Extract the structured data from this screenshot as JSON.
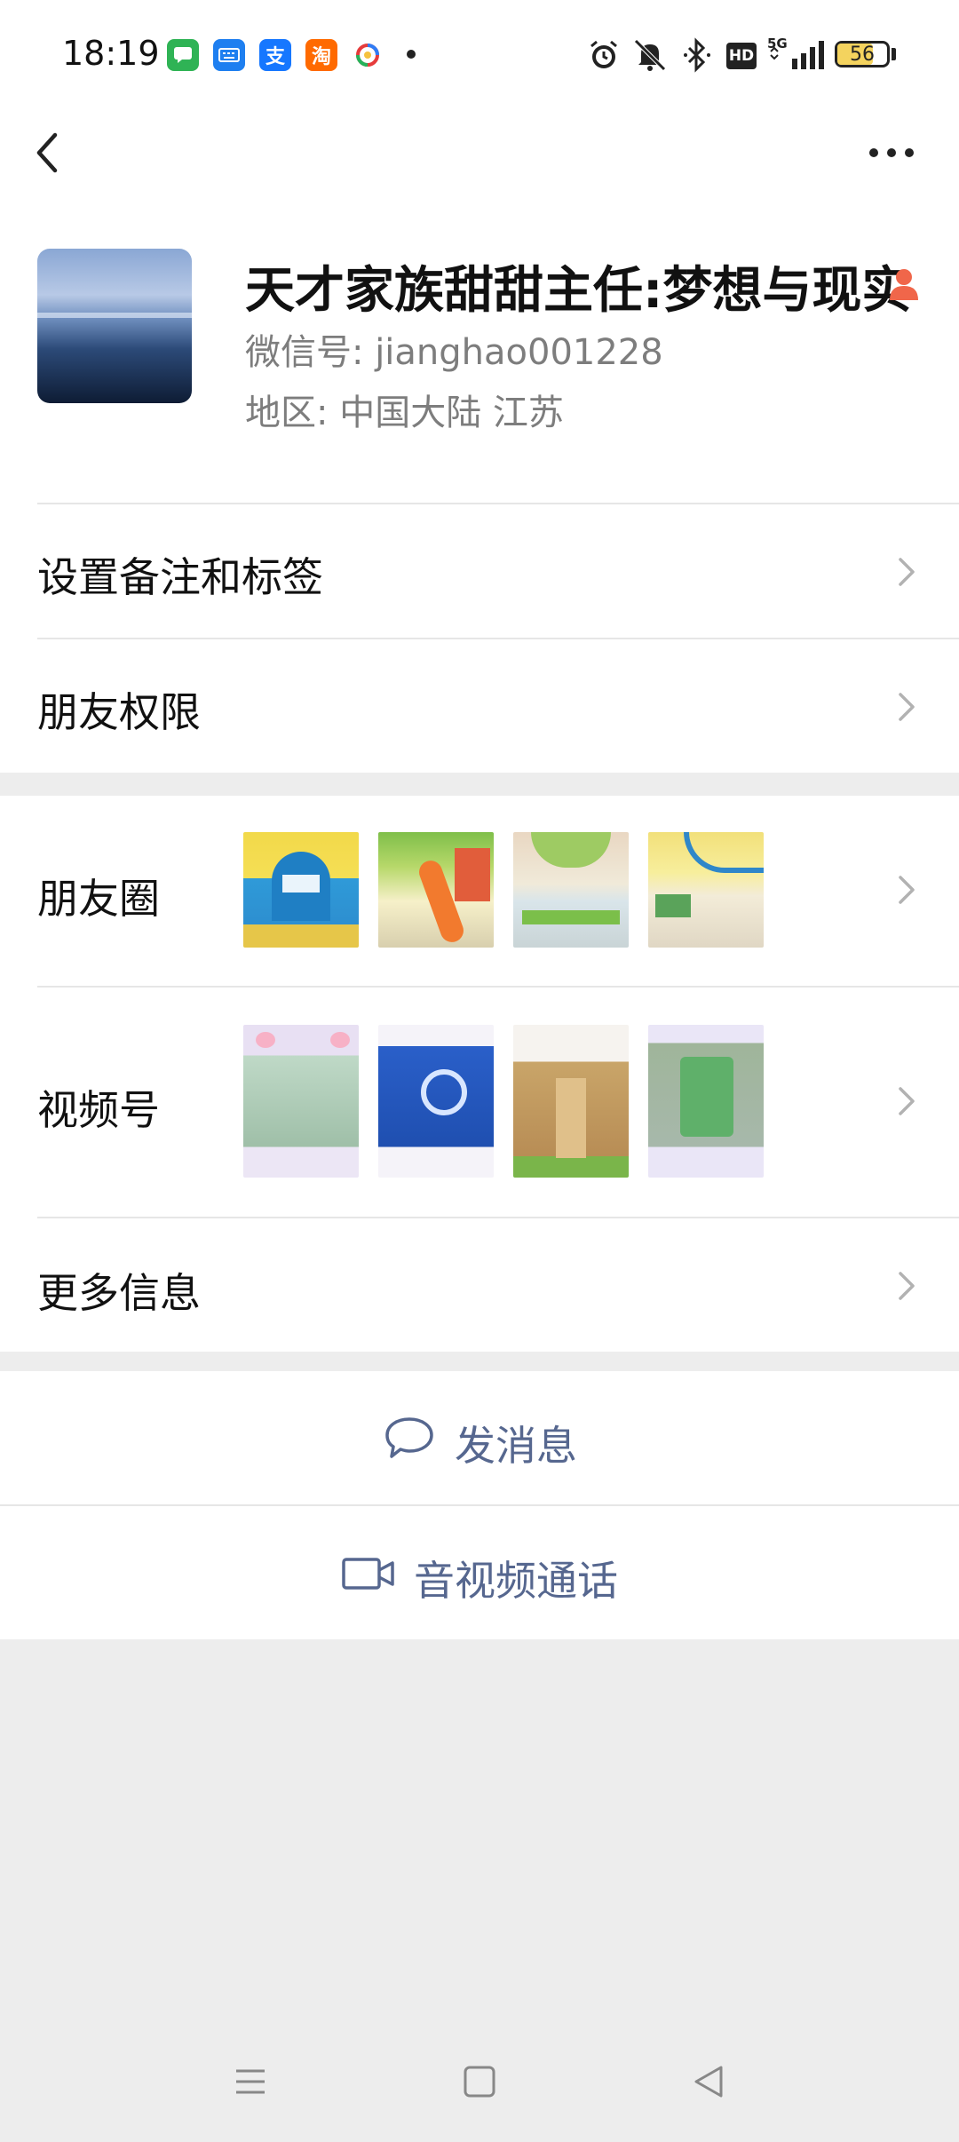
{
  "status_bar": {
    "time": "18:19",
    "network": "5G",
    "hd": "HD",
    "battery": "56",
    "apps": [
      {
        "name": "messages-app-icon",
        "color": "#2fb355",
        "glyph": "▤"
      },
      {
        "name": "keyboard-app-icon",
        "color": "#1e7ff0",
        "glyph": "⌨"
      },
      {
        "name": "alipay-app-icon",
        "color": "#1677ff",
        "glyph": "支"
      },
      {
        "name": "taobao-app-icon",
        "color": "#ff6a00",
        "glyph": "淘"
      }
    ]
  },
  "profile": {
    "name": "天才家族甜甜主任:梦想与现实",
    "wechat_id": "微信号:  jianghao001228",
    "region": "地区:  中国大陆  江苏"
  },
  "menu": {
    "remark_tags": "设置备注和标签",
    "friend_permissions": "朋友权限",
    "moments": "朋友圈",
    "channels": "视频号",
    "more_info": "更多信息"
  },
  "actions": {
    "send_message": "发消息",
    "av_call": "音视频通话"
  },
  "colors": {
    "accent_text": "#56678f",
    "background": "#ededed",
    "person_icon": "#f0664a"
  }
}
